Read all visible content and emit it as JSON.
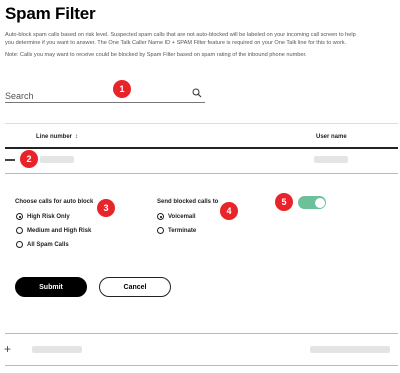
{
  "title": "Spam Filter",
  "description_line1": "Auto-block spam calls based on risk level. Suspected spam calls that are not auto-blocked will be labeled on your incoming call screen to help",
  "description_line2": "you determine if you want to answer. The One Talk Caller Name ID + SPAM Filter feature is required on your One Talk line for this to work.",
  "note": "Note: Calls you may want to receive could be blocked by Spam Filter based on spam rating of the inbound phone number.",
  "search": {
    "placeholder": "Search"
  },
  "table": {
    "headers": {
      "line_number": "Line number",
      "user_name": "User name"
    },
    "sort_icon": "sort-arrows"
  },
  "auto_block": {
    "title": "Choose calls for auto block",
    "options": [
      "High Risk Only",
      "Medium and High Risk",
      "All Spam Calls"
    ],
    "selected": "High Risk Only"
  },
  "send_blocked": {
    "title": "Send blocked calls to",
    "options": [
      "Voicemail",
      "Terminate"
    ],
    "selected": "Voicemail"
  },
  "toggle": {
    "enabled": true,
    "color": "#6cc09a"
  },
  "buttons": {
    "submit": "Submit",
    "cancel": "Cancel"
  },
  "callouts": [
    "1",
    "2",
    "3",
    "4",
    "5"
  ],
  "colors": {
    "callout": "#e8242a",
    "toggle_on": "#6cc09a"
  }
}
